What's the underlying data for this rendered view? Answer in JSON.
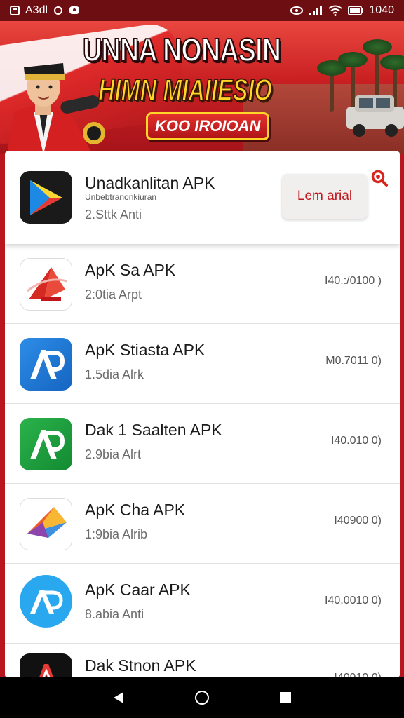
{
  "status_bar": {
    "left_text": "A3dl",
    "time": "1040",
    "icons": [
      "notification-square-icon",
      "sync-circle-icon",
      "message-icon",
      "eye-icon",
      "signal-icon",
      "wifi-icon",
      "battery-icon"
    ]
  },
  "banner": {
    "title_line1": "UNNA NONASIN",
    "title_line2": "HIMN MIAIIESIO",
    "badge_text": "KOO IROIOAN"
  },
  "featured": {
    "title": "Unadkanlitan APK",
    "subtitle": "Unbebtranonkiuran",
    "meta": "2.Sttk Anti",
    "button_label": "Lem arial",
    "icon": "play-triangle-icon"
  },
  "apps": [
    {
      "title": "ApK Sa APK",
      "meta": "2:0tia Arpt",
      "size": "I40.:/0100 )",
      "icon": "red-arrow-logo-icon"
    },
    {
      "title": "ApK Stiasta APK",
      "meta": "1.5dia Alrk",
      "size": "M0.7011 0)",
      "icon": "blue-ap-logo-icon"
    },
    {
      "title": "Dak 1 Saalten APK",
      "meta": "2.9bia Alrt",
      "size": "I40.010 0)",
      "icon": "green-ap-logo-icon"
    },
    {
      "title": "ApK Cha APK",
      "meta": "1:9bia Alrib",
      "size": "I40900 0)",
      "icon": "colorful-play-icon"
    },
    {
      "title": "ApK Caar APK",
      "meta": "8.abia Anti",
      "size": "I40.0010 0)",
      "icon": "round-ap-logo-icon"
    },
    {
      "title": "Dak Stnon APK",
      "meta": "",
      "size": "I40910 0)",
      "icon": "black-a-logo-icon"
    }
  ],
  "navbar": {
    "icons": [
      "back-triangle-icon",
      "home-circle-icon",
      "recents-square-icon"
    ]
  },
  "colors": {
    "accent": "#c0161c",
    "banner_red": "#c91f22",
    "banner_yellow": "#ffd528"
  }
}
